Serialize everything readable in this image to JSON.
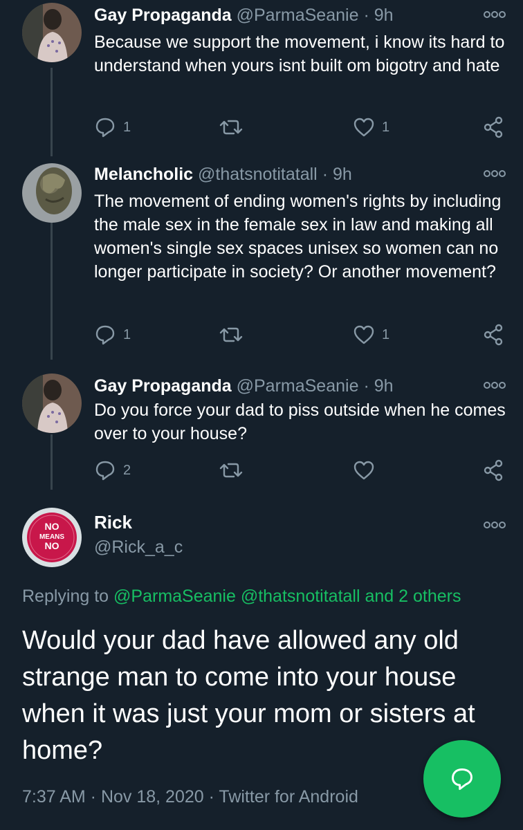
{
  "tweets": [
    {
      "name": "Gay Propaganda",
      "handle": "@ParmaSeanie",
      "time": "· 9h",
      "text": "Because we support the movement, i know its hard to understand when yours isnt built om bigotry and hate",
      "replies": "1",
      "retweets": "",
      "likes": "1"
    },
    {
      "name": "Melancholic",
      "handle": "@thatsnotitatall",
      "time": "· 9h",
      "text": "The movement of ending women's rights by including the male sex in the female sex in law and making all women's single sex spaces unisex so women can no longer participate in society? Or another movement?",
      "replies": "1",
      "retweets": "",
      "likes": "1"
    },
    {
      "name": "Gay Propaganda",
      "handle": "@ParmaSeanie",
      "time": "· 9h",
      "text": "Do you force your dad to piss outside when he comes over to your house?",
      "replies": "2",
      "retweets": "",
      "likes": ""
    }
  ],
  "main_tweet": {
    "name": "Rick",
    "handle": "@Rick_a_c",
    "avatar_badge": [
      "NO",
      "MEANS",
      "NO"
    ],
    "replying_prefix": "Replying to",
    "replying_to": "@ParmaSeanie @thatsnotitatall and 2 others",
    "text": "Would your dad have allowed any old strange man to come into your house when it was just your mom or sisters at home?",
    "timestamp": "7:37 AM · Nov 18, 2020 · Twitter for Android"
  },
  "colors": {
    "background": "#15202b",
    "muted": "#8899a6",
    "accent": "#17bf63",
    "thread_line": "#38444d"
  },
  "icons": [
    "reply-icon",
    "retweet-icon",
    "like-icon",
    "share-icon",
    "more-icon",
    "compose-reply-icon"
  ]
}
